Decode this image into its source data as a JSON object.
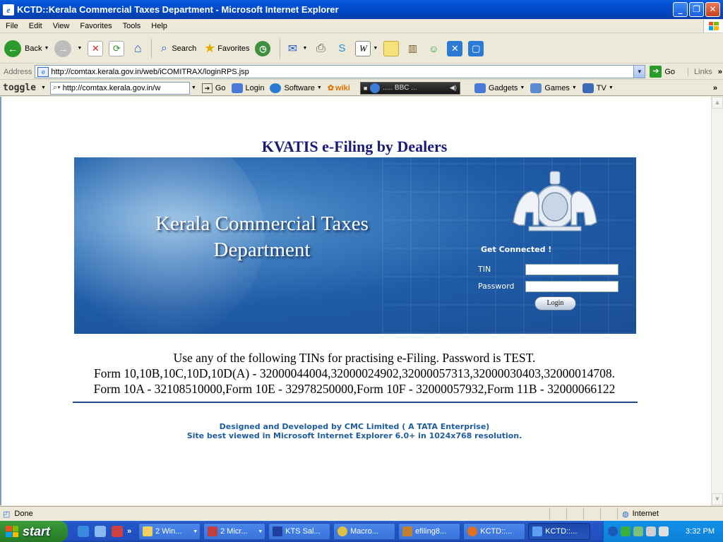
{
  "window": {
    "title": "KCTD::Kerala Commercial Taxes Department - Microsoft Internet Explorer",
    "app_icon": "ie-page-icon",
    "controls": [
      "minimize",
      "restore",
      "close"
    ]
  },
  "menubar": {
    "items": [
      "File",
      "Edit",
      "View",
      "Favorites",
      "Tools",
      "Help"
    ]
  },
  "toolbar": {
    "back_label": "Back",
    "search_label": "Search",
    "favorites_label": "Favorites"
  },
  "addressbar": {
    "label": "Address",
    "url": "http://comtax.kerala.gov.in/web/iCOMITRAX/loginRPS.jsp",
    "go_label": "Go",
    "links_label": "Links"
  },
  "googlebar": {
    "toggle_label": "toggle",
    "search_value": "http://comtax.kerala.gov.in/w",
    "go_label": "Go",
    "login_label": "Login",
    "software_label": "Software",
    "wiki_label": "wiki",
    "player_text": "..... BBC ...",
    "gadgets_label": "Gadgets",
    "games_label": "Games",
    "tv_label": "TV"
  },
  "page": {
    "heading": "KVATIS e-Filing by Dealers",
    "banner": {
      "dept_line1": "Kerala Commercial Taxes",
      "dept_line2": "Department",
      "get_connected": "Get Connected !",
      "tin_label": "TIN",
      "tin_value": "",
      "password_label": "Password",
      "password_value": "",
      "login_button": "Login"
    },
    "notice_line1": "Use any of the following TINs for practising e-Filing. Password is TEST.",
    "notice_line2": "Form 10,10B,10C,10D,10D(A) - 32000044004,32000024902,32000057313,32000030403,32000014708.",
    "notice_line3": "Form 10A - 32108510000,Form 10E - 32978250000,Form 10F - 32000057932,Form 11B - 32000066122",
    "credit_line1": "Designed and Developed by CMC Limited ( A TATA Enterprise)",
    "credit_line2": "Site best viewed in Microsoft Internet Explorer 6.0+ in 1024x768 resolution."
  },
  "statusbar": {
    "status": "Done",
    "zone": "Internet"
  },
  "taskbar": {
    "start_label": "start",
    "tasks": [
      "2 Win...",
      "2 Micr...",
      "KTS Sal...",
      "Macro...",
      "efiling8...",
      "KCTD::...",
      "KCTD::..."
    ],
    "clock": "3:32 PM"
  },
  "colors": {
    "heading": "#1a1a78",
    "banner_blue": "#1f5ba6",
    "credit_blue": "#1f5c9e",
    "taskbar_blue": "#245edb",
    "start_green": "#2f8a2f"
  }
}
